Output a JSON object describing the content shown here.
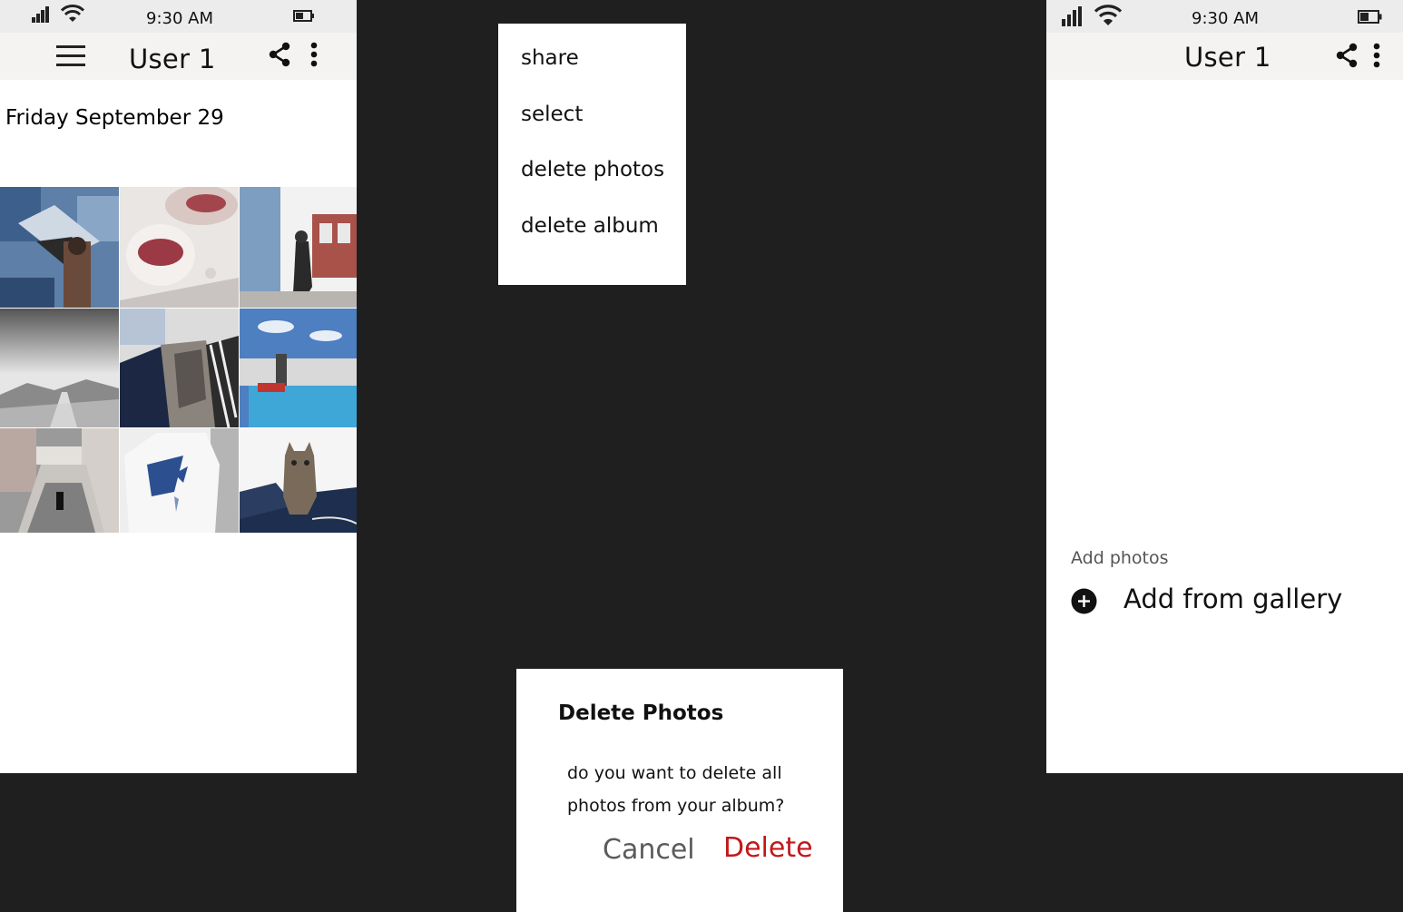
{
  "left_screen": {
    "status": {
      "time": "9:30 AM"
    },
    "app_bar": {
      "title": "User 1"
    },
    "date_heading": "Friday September 29",
    "photos": [
      {
        "subject": "woman with shark mural"
      },
      {
        "subject": "dessert plate"
      },
      {
        "subject": "person on street"
      },
      {
        "subject": "snowy road landscape"
      },
      {
        "subject": "person holding cat"
      },
      {
        "subject": "rooftop pool cityscape"
      },
      {
        "subject": "person on ornate stairs"
      },
      {
        "subject": "white t-shirt with print"
      },
      {
        "subject": "kitten on cushion"
      }
    ]
  },
  "overflow_menu": {
    "items": [
      {
        "id": "share",
        "label": "share"
      },
      {
        "id": "select",
        "label": "select"
      },
      {
        "id": "delete-photos",
        "label": "delete photos"
      },
      {
        "id": "delete-album",
        "label": "delete album"
      }
    ]
  },
  "delete_dialog": {
    "title": "Delete Photos",
    "message": "do you want to delete all photos from your album?",
    "cancel_label": "Cancel",
    "delete_label": "Delete",
    "colors": {
      "delete": "#c0181b",
      "cancel": "#5b5b5b"
    }
  },
  "right_screen": {
    "status": {
      "time": "9:30 AM"
    },
    "app_bar": {
      "title": "User 1"
    },
    "add_photos": {
      "caption": "Add photos",
      "action_label": "Add from gallery"
    }
  },
  "icons": [
    "signal-icon",
    "wifi-icon",
    "battery-icon",
    "menu-icon",
    "share-icon",
    "more-vert-icon",
    "add-circle-icon"
  ],
  "theme": {
    "backdrop": "#1f1f1f",
    "status_bar": "#ececec",
    "app_bar": "#f5f3f2"
  }
}
